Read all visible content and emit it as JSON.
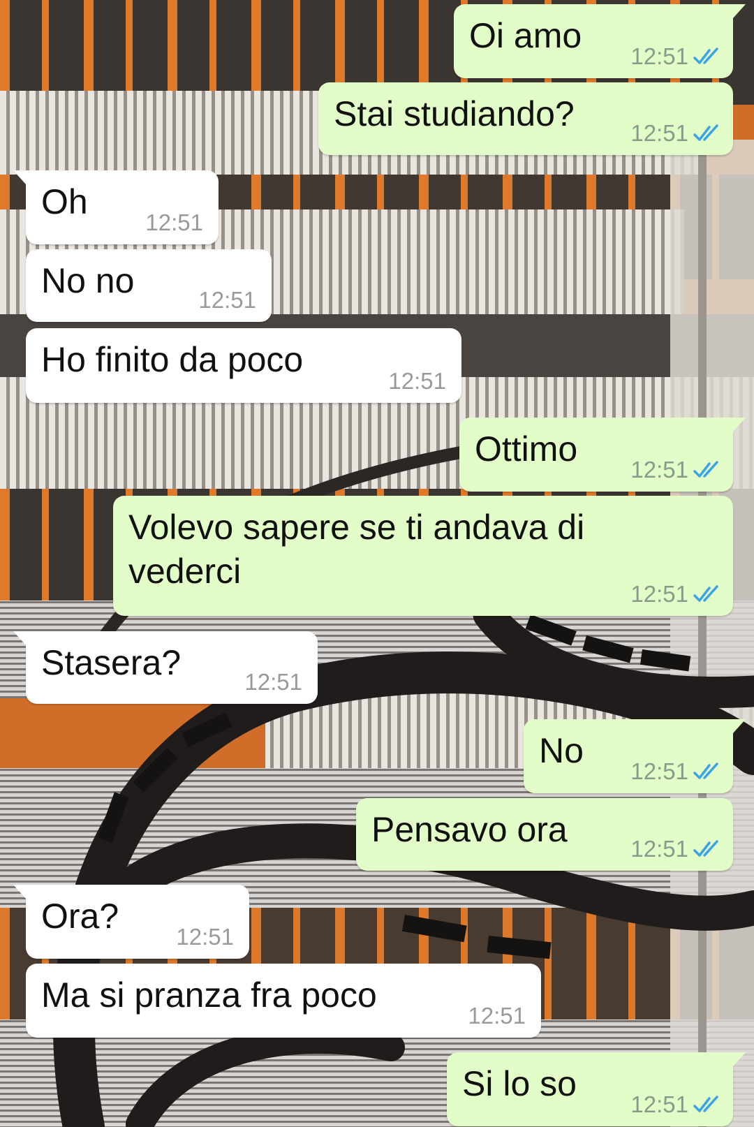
{
  "wallpaper": {
    "subject": "building-with-spiral-staircase"
  },
  "colors": {
    "incoming_bubble": "#ffffff",
    "outgoing_bubble": "#e2fdc8",
    "read_ticks": "#3aa3e3",
    "timestamp": "#8a9a8a"
  },
  "messages": [
    {
      "text": "Oi amo",
      "time": "12:51",
      "direction": "out",
      "status_icon": "double-check-read-icon"
    },
    {
      "text": "Stai studiando?",
      "time": "12:51",
      "direction": "out",
      "status_icon": "double-check-read-icon"
    },
    {
      "text": "Oh",
      "time": "12:51",
      "direction": "in"
    },
    {
      "text": "No no",
      "time": "12:51",
      "direction": "in"
    },
    {
      "text": "Ho finito da poco",
      "time": "12:51",
      "direction": "in"
    },
    {
      "text": "Ottimo",
      "time": "12:51",
      "direction": "out",
      "status_icon": "double-check-read-icon"
    },
    {
      "text": "Volevo sapere se ti andava di\nvederci",
      "time": "12:51",
      "direction": "out",
      "status_icon": "double-check-read-icon"
    },
    {
      "text": "Stasera?",
      "time": "12:51",
      "direction": "in"
    },
    {
      "text": "No",
      "time": "12:51",
      "direction": "out",
      "status_icon": "double-check-read-icon"
    },
    {
      "text": "Pensavo ora",
      "time": "12:51",
      "direction": "out",
      "status_icon": "double-check-read-icon"
    },
    {
      "text": "Ora?",
      "time": "12:51",
      "direction": "in"
    },
    {
      "text": "Ma si pranza fra poco",
      "time": "12:51",
      "direction": "in"
    },
    {
      "text": "Si lo so",
      "time": "12:51",
      "direction": "out",
      "status_icon": "double-check-read-icon"
    }
  ]
}
